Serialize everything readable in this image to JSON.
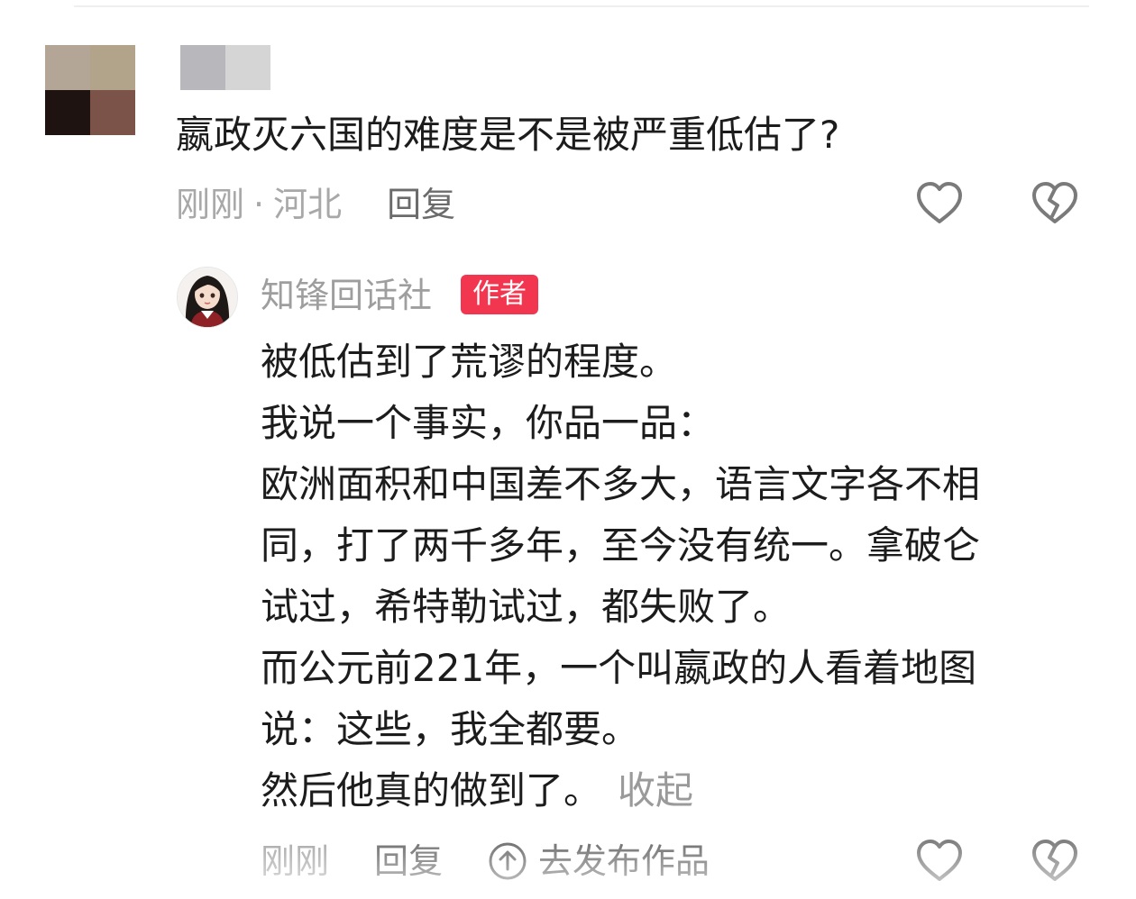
{
  "comment": {
    "avatar_colors": [
      "#b4a697",
      "#b2a48b",
      "#1f1311",
      "#7b5348"
    ],
    "name_colors": [
      "#b8b8bc",
      "#d5d5d5"
    ],
    "text": "嬴政灭六国的难度是不是被严重低估了?",
    "time": "刚刚",
    "separator": "·",
    "location": "河北",
    "reply_label": "回复",
    "icons": {
      "like": "heart-icon",
      "dislike": "broken-heart-icon"
    }
  },
  "reply": {
    "author": "知锋回话社",
    "badge": "作者",
    "lines": [
      "被低估到了荒谬的程度。",
      "我说一个事实，你品一品：",
      "欧洲面积和中国差不多大，语言文字各不相",
      "同，打了两千多年，至今没有统一。拿破仑",
      "试过，希特勒试过，都失败了。",
      "而公元前221年，一个叫嬴政的人看着地图",
      "说：这些，我全都要。",
      "然后他真的做到了。"
    ],
    "collapse_label": "收起",
    "time": "刚刚",
    "reply_label": "回复",
    "publish_label": "去发布作品",
    "badge_color": "#f2364f",
    "icons": {
      "avatar": "anime-girl-avatar",
      "publish": "upload-arrow-icon"
    }
  }
}
